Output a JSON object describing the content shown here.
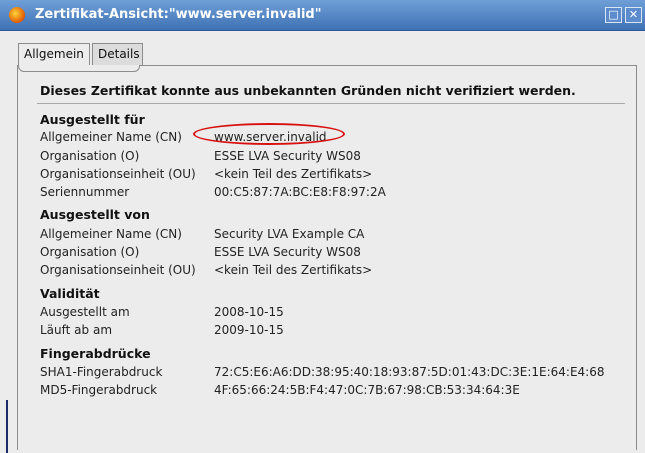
{
  "window": {
    "title": "Zertifikat-Ansicht:\"www.server.invalid\"",
    "maximize_glyph": "□",
    "close_glyph": "✕"
  },
  "tabs": [
    {
      "label": "Allgemein",
      "active": true
    },
    {
      "label": "Details",
      "active": false
    }
  ],
  "note": "Dieses Zertifikat konnte aus unbekannten Gründen nicht verifiziert werden.",
  "issued_to": {
    "title": "Ausgestellt für",
    "rows": [
      {
        "label": "Allgemeiner Name (CN)",
        "value": "www.server.invalid"
      },
      {
        "label": "Organisation (O)",
        "value": "ESSE LVA Security WS08"
      },
      {
        "label": "Organisationseinheit (OU)",
        "value": "<kein Teil des Zertifikats>"
      },
      {
        "label": "Seriennummer",
        "value": "00:C5:87:7A:BC:E8:F8:97:2A"
      }
    ]
  },
  "issued_by": {
    "title": "Ausgestellt von",
    "rows": [
      {
        "label": "Allgemeiner Name (CN)",
        "value": "Security LVA Example CA"
      },
      {
        "label": "Organisation (O)",
        "value": "ESSE LVA Security WS08"
      },
      {
        "label": "Organisationseinheit (OU)",
        "value": "<kein Teil des Zertifikats>"
      }
    ]
  },
  "validity": {
    "title": "Validität",
    "rows": [
      {
        "label": "Ausgestellt am",
        "value": "2008-10-15"
      },
      {
        "label": "Läuft ab am",
        "value": "2009-10-15"
      }
    ]
  },
  "fingerprints": {
    "title": "Fingerabdrücke",
    "rows": [
      {
        "label": "SHA1-Fingerabdruck",
        "value": "72:C5:E6:A6:DD:38:95:40:18:93:87:5D:01:43:DC:3E:1E:64:E4:68"
      },
      {
        "label": "MD5-Fingerabdruck",
        "value": "4F:65:66:24:5B:F4:47:0C:7B:67:98:CB:53:34:64:3E"
      }
    ]
  },
  "colors": {
    "titlebar": "#3f72b5",
    "highlight_ring": "#d91010",
    "panel": "#ececec"
  }
}
